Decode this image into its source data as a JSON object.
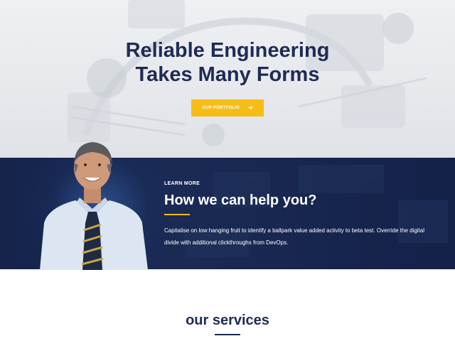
{
  "colors": {
    "navy": "#1e2b55",
    "accent_yellow": "#f6bd16",
    "band_navy": "#16244c",
    "white": "#ffffff"
  },
  "hero": {
    "title_line1": "Reliable Engineering",
    "title_line2": "Takes Many Forms",
    "button_label": "OUR PORTFOLIO",
    "button_icon": "arrow-right-icon"
  },
  "help": {
    "eyebrow": "LEARN MORE",
    "heading": "How we can help you?",
    "body": "Capitalise on low hanging fruit to identify a ballpark value added activity to beta test. Override the digital divide with additional clickthroughs from DevOps."
  },
  "services": {
    "title": "our services"
  }
}
